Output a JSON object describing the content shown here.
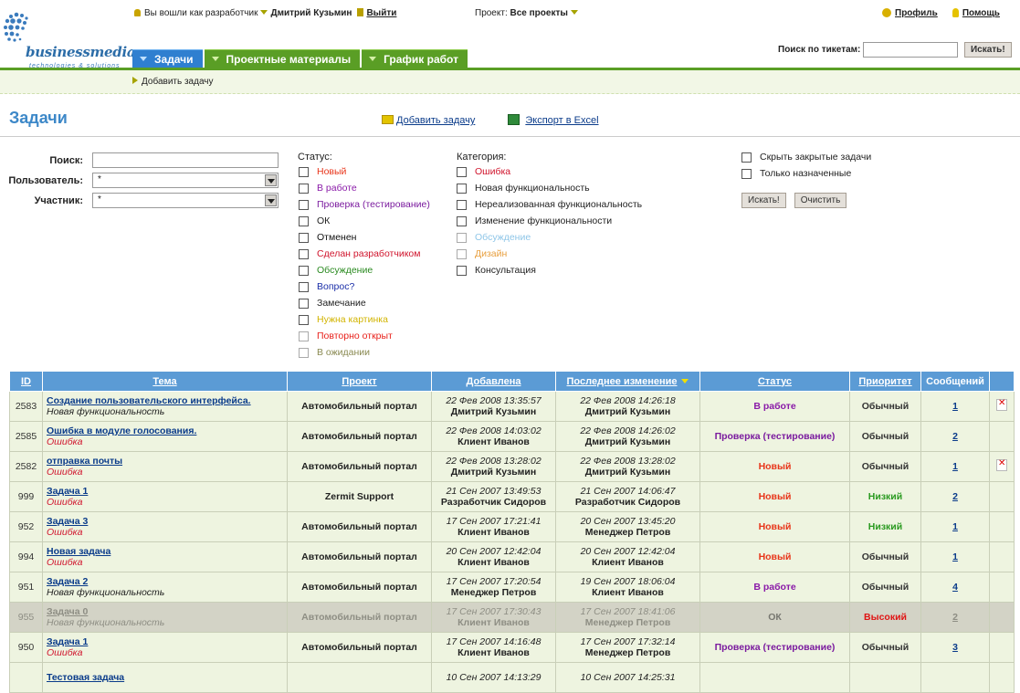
{
  "header": {
    "logo_text": "businessmedia",
    "logo_sub": "technologies & solutions",
    "logged_in_prefix": "Вы вошли как разработчик",
    "user_name": "Дмитрий Кузьмин",
    "logout": "Выйти",
    "project_label": "Проект:",
    "project_value": "Все проекты",
    "profile": "Профиль",
    "help": "Помощь",
    "ticket_search_label": "Поиск по тикетам:",
    "ticket_search_button": "Искать!"
  },
  "tabs": [
    {
      "label": "Задачи",
      "active": true
    },
    {
      "label": "Проектные материалы",
      "active": false
    },
    {
      "label": "График работ",
      "active": false
    }
  ],
  "subbar": {
    "add_task": "Добавить задачу"
  },
  "page": {
    "title": "Задачи",
    "add_task_link": "Добавить задачу",
    "export_link": "Экспорт в Excel"
  },
  "filters": {
    "search_label": "Поиск:",
    "search_value": "",
    "user_label": "Пользователь:",
    "user_value": "*",
    "participant_label": "Участник:",
    "participant_value": "*",
    "status_title": "Статус:",
    "statuses": [
      {
        "label": "Новый",
        "color": "#e8351a"
      },
      {
        "label": "В работе",
        "color": "#8a1aa8"
      },
      {
        "label": "Проверка (тестирование)",
        "color": "#7a1a9e"
      },
      {
        "label": "ОК",
        "color": "#222222"
      },
      {
        "label": "Отменен",
        "color": "#111111"
      },
      {
        "label": "Сделан разработчиком",
        "color": "#d0142c"
      },
      {
        "label": "Обсуждение",
        "color": "#2a8a20"
      },
      {
        "label": "Вопрос?",
        "color": "#1a2ea8"
      },
      {
        "label": "Замечание",
        "color": "#222222"
      },
      {
        "label": "Нужна картинка",
        "color": "#d2b400"
      },
      {
        "label": "Повторно открыт",
        "color": "#e8201a"
      },
      {
        "label": "В ожидании",
        "color": "#8a8a52"
      }
    ],
    "category_title": "Категория:",
    "categories": [
      {
        "label": "Ошибка",
        "color": "#d0142c"
      },
      {
        "label": "Новая функциональность",
        "color": "#222222"
      },
      {
        "label": "Нереализованная функциональность",
        "color": "#222222"
      },
      {
        "label": "Изменение функциональности",
        "color": "#222222"
      },
      {
        "label": "Обсуждение",
        "color": "#8fc6e8"
      },
      {
        "label": "Дизайн",
        "color": "#e8a040"
      },
      {
        "label": "Консультация",
        "color": "#222222"
      }
    ],
    "hide_closed": "Скрыть закрытые задачи",
    "only_assigned": "Только назначенные",
    "search_button": "Искать!",
    "clear_button": "Очистить"
  },
  "table": {
    "columns": [
      "ID",
      "Тема",
      "Проект",
      "Добавлена",
      "Последнее изменение",
      "Статус",
      "Приоритет",
      "Сообщений"
    ],
    "rows": [
      {
        "id": "2583",
        "title": "Создание пользовательского интерфейса.",
        "category": "Новая функциональность",
        "category_color": "#222222",
        "project": "Автомобильный портал",
        "added_date": "22 Фев 2008 13:35:57",
        "added_by": "Дмитрий Кузьмин",
        "changed_date": "22 Фев 2008 14:26:18",
        "changed_by": "Дмитрий Кузьмин",
        "status": "В работе",
        "status_color": "#8a1aa8",
        "priority": "Обычный",
        "priority_color": "#333333",
        "messages": "1",
        "deletable": true,
        "closed": false
      },
      {
        "id": "2585",
        "title": "Ошибка в модуле голосования.",
        "category": "Ошибка",
        "category_color": "#d0142c",
        "project": "Автомобильный портал",
        "added_date": "22 Фев 2008 14:03:02",
        "added_by": "Клиент Иванов",
        "changed_date": "22 Фев 2008 14:26:02",
        "changed_by": "Дмитрий Кузьмин",
        "status": "Проверка (тестирование)",
        "status_color": "#7a1a9e",
        "priority": "Обычный",
        "priority_color": "#333333",
        "messages": "2",
        "deletable": false,
        "closed": false
      },
      {
        "id": "2582",
        "title": "отправка почты",
        "category": "Ошибка",
        "category_color": "#d0142c",
        "project": "Автомобильный портал",
        "added_date": "22 Фев 2008 13:28:02",
        "added_by": "Дмитрий Кузьмин",
        "changed_date": "22 Фев 2008 13:28:02",
        "changed_by": "Дмитрий Кузьмин",
        "status": "Новый",
        "status_color": "#e8351a",
        "priority": "Обычный",
        "priority_color": "#333333",
        "messages": "1",
        "deletable": true,
        "closed": false
      },
      {
        "id": "999",
        "title": "Задача 1",
        "category": "Ошибка",
        "category_color": "#d0142c",
        "project": "Zermit Support",
        "added_date": "21 Сен 2007 13:49:53",
        "added_by": "Разработчик Сидоров",
        "changed_date": "21 Сен 2007 14:06:47",
        "changed_by": "Разработчик Сидоров",
        "status": "Новый",
        "status_color": "#e8351a",
        "priority": "Низкий",
        "priority_color": "#2a9a20",
        "messages": "2",
        "deletable": false,
        "closed": false
      },
      {
        "id": "952",
        "title": "Задача 3",
        "category": "Ошибка",
        "category_color": "#d0142c",
        "project": "Автомобильный портал",
        "added_date": "17 Сен 2007 17:21:41",
        "added_by": "Клиент Иванов",
        "changed_date": "20 Сен 2007 13:45:20",
        "changed_by": "Менеджер Петров",
        "status": "Новый",
        "status_color": "#e8351a",
        "priority": "Низкий",
        "priority_color": "#2a9a20",
        "messages": "1",
        "deletable": false,
        "closed": false
      },
      {
        "id": "994",
        "title": "Новая задача",
        "category": "Ошибка",
        "category_color": "#d0142c",
        "project": "Автомобильный портал",
        "added_date": "20 Сен 2007 12:42:04",
        "added_by": "Клиент Иванов",
        "changed_date": "20 Сен 2007 12:42:04",
        "changed_by": "Клиент Иванов",
        "status": "Новый",
        "status_color": "#e8351a",
        "priority": "Обычный",
        "priority_color": "#333333",
        "messages": "1",
        "deletable": false,
        "closed": false
      },
      {
        "id": "951",
        "title": "Задача 2",
        "category": "Новая функциональность",
        "category_color": "#222222",
        "project": "Автомобильный портал",
        "added_date": "17 Сен 2007 17:20:54",
        "added_by": "Менеджер Петров",
        "changed_date": "19 Сен 2007 18:06:04",
        "changed_by": "Клиент Иванов",
        "status": "В работе",
        "status_color": "#8a1aa8",
        "priority": "Обычный",
        "priority_color": "#333333",
        "messages": "4",
        "deletable": false,
        "closed": false
      },
      {
        "id": "955",
        "title": "Задача 0",
        "category": "Новая функциональность",
        "category_color": "#8e8e84",
        "project": "Автомобильный портал",
        "added_date": "17 Сен 2007 17:30:43",
        "added_by": "Клиент Иванов",
        "changed_date": "17 Сен 2007 18:41:06",
        "changed_by": "Менеджер Петров",
        "status": "ОК",
        "status_color": "#777770",
        "priority": "Высокий",
        "priority_color": "#e01414",
        "messages": "2",
        "deletable": false,
        "closed": true
      },
      {
        "id": "950",
        "title": "Задача 1",
        "category": "Ошибка",
        "category_color": "#d0142c",
        "project": "Автомобильный портал",
        "added_date": "17 Сен 2007 14:16:48",
        "added_by": "Клиент Иванов",
        "changed_date": "17 Сен 2007 17:32:14",
        "changed_by": "Менеджер Петров",
        "status": "Проверка (тестирование)",
        "status_color": "#7a1a9e",
        "priority": "Обычный",
        "priority_color": "#333333",
        "messages": "3",
        "deletable": false,
        "closed": false
      },
      {
        "id": "",
        "title": "Тестовая задача",
        "category": "",
        "category_color": "#222222",
        "project": "",
        "added_date": "10 Сен 2007 14:13:29",
        "added_by": "",
        "changed_date": "10 Сен 2007 14:25:31",
        "changed_by": "",
        "status": "",
        "status_color": "#e8351a",
        "priority": "",
        "priority_color": "#333333",
        "messages": "",
        "deletable": false,
        "closed": false
      }
    ]
  }
}
